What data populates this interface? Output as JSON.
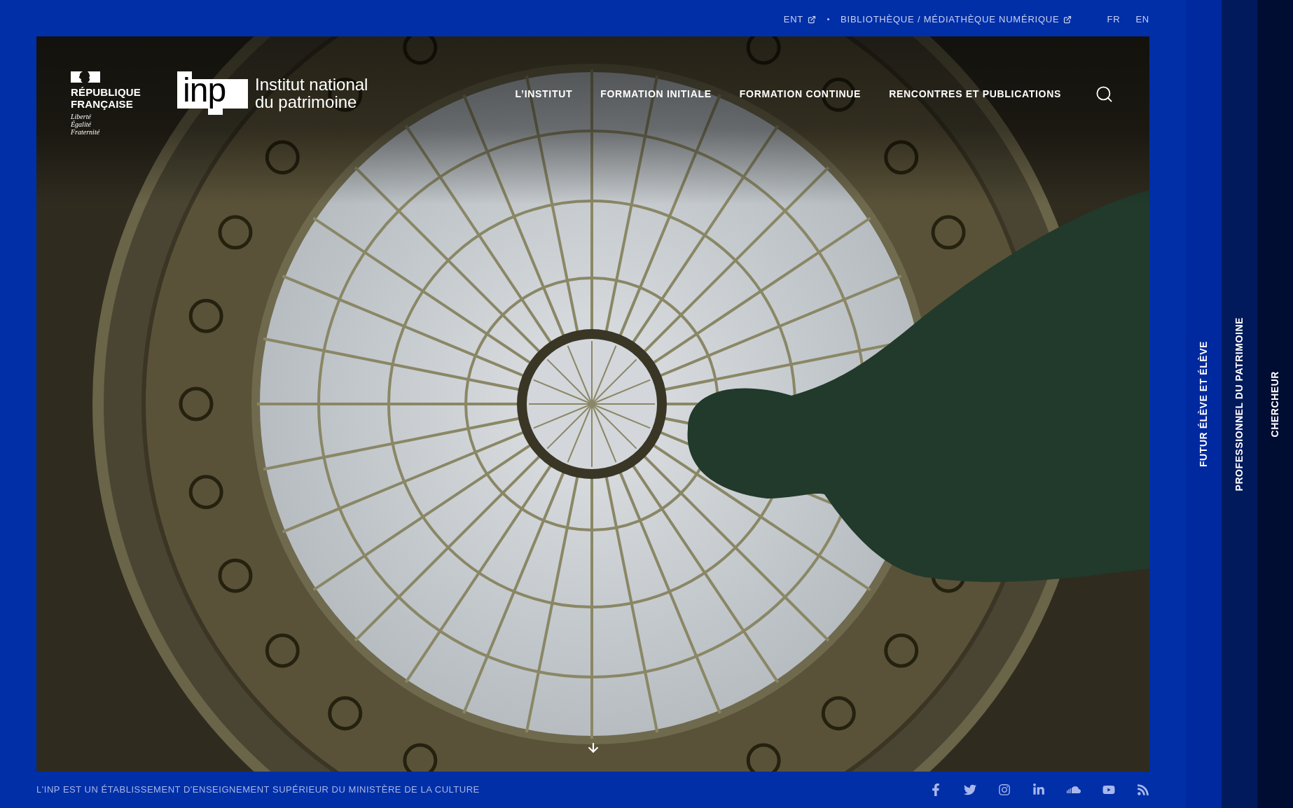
{
  "top_bar": {
    "links": [
      {
        "label": "ENT",
        "external": true
      },
      {
        "label": "BIBLIOTHÈQUE / MÉDIATHÈQUE NUMÉRIQUE",
        "external": true
      }
    ],
    "languages": [
      {
        "label": "FR"
      },
      {
        "label": "EN"
      }
    ]
  },
  "header": {
    "republique": {
      "name_lines": [
        "RÉPUBLIQUE",
        "FRANÇAISE"
      ],
      "motto_lines": [
        "Liberté",
        "Égalité",
        "Fraternité"
      ]
    },
    "inp": {
      "mark": "inp",
      "name_lines": [
        "Institut national",
        "du patrimoine"
      ]
    },
    "nav": [
      {
        "label": "L’INSTITUT"
      },
      {
        "label": "FORMATION INITIALE"
      },
      {
        "label": "FORMATION CONTINUE"
      },
      {
        "label": "RENCONTRES ET PUBLICATIONS"
      }
    ]
  },
  "footer": {
    "text": "L'INP EST UN ÉTABLISSEMENT D'ENSEIGNEMENT SUPÉRIEUR DU MINISTÈRE DE LA CULTURE"
  },
  "audience_tabs": [
    {
      "label": "FUTUR ÉLÈVE ET ÉLÈVE",
      "color": "#0029a0"
    },
    {
      "label": "PROFESSIONNEL DU PATRIMOINE",
      "color": "#001a5c"
    },
    {
      "label": "CHERCHEUR",
      "color": "#000d33"
    }
  ]
}
